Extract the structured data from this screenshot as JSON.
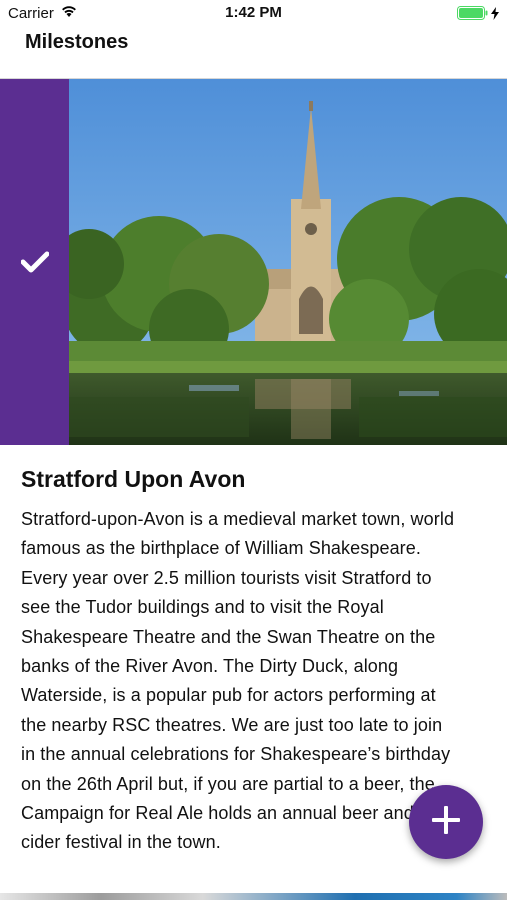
{
  "status_bar": {
    "carrier": "Carrier",
    "time": "1:42 PM",
    "battery_color": "#4cd964"
  },
  "nav": {
    "title": "Milestones"
  },
  "card": {
    "accent_color": "#5b2e91",
    "status_icon": "check-icon",
    "image_subject": "church-spire-by-river",
    "title": "Stratford Upon Avon",
    "body_lines": [
      "Stratford-upon-Avon is a medieval market town, world",
      "famous as the birthplace of William Shakespeare.",
      "Every year over 2.5 million tourists visit Stratford to",
      "see the Tudor buildings and to visit the Royal",
      "Shakespeare Theatre and the Swan Theatre on the",
      "banks of the River Avon. The Dirty Duck, along",
      "Waterside, is a popular pub for actors performing at",
      "the nearby RSC theatres. We are just too late to join",
      "in the annual celebrations for Shakespeare’s birthday",
      "on the 26th April but, if you are partial to a beer, the",
      "Campaign for Real Ale holds an annual beer and",
      "cider festival in the town."
    ]
  },
  "fab": {
    "icon": "plus-icon",
    "color": "#5b2e91"
  }
}
